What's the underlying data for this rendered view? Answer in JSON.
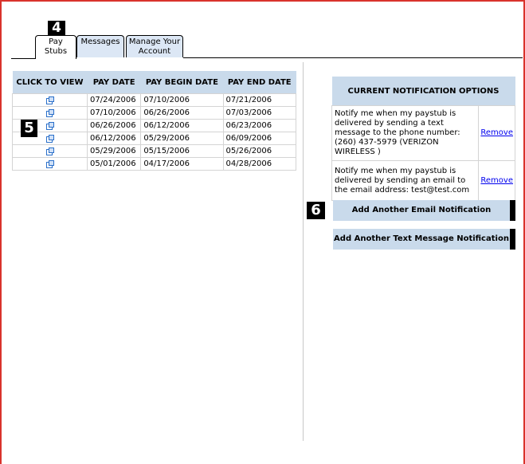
{
  "callouts": {
    "c4": "4",
    "c5": "5",
    "c6": "6"
  },
  "tabs": [
    {
      "label": "Pay Stubs"
    },
    {
      "label": "Messages"
    },
    {
      "label": "Manage Your Account"
    }
  ],
  "paystubs": {
    "headers": [
      "CLICK TO VIEW",
      "PAY DATE",
      "PAY BEGIN DATE",
      "PAY END DATE"
    ],
    "rows": [
      {
        "pay_date": "07/24/2006",
        "begin": "07/10/2006",
        "end": "07/21/2006"
      },
      {
        "pay_date": "07/10/2006",
        "begin": "06/26/2006",
        "end": "07/03/2006"
      },
      {
        "pay_date": "06/26/2006",
        "begin": "06/12/2006",
        "end": "06/23/2006"
      },
      {
        "pay_date": "06/12/2006",
        "begin": "05/29/2006",
        "end": "06/09/2006"
      },
      {
        "pay_date": "05/29/2006",
        "begin": "05/15/2006",
        "end": "05/26/2006"
      },
      {
        "pay_date": "05/01/2006",
        "begin": "04/17/2006",
        "end": "04/28/2006"
      }
    ],
    "view_icon": "external-link-icon"
  },
  "notifications": {
    "header": "CURRENT NOTIFICATION OPTIONS",
    "items": [
      {
        "text": "Notify me when my paystub is delivered by sending a text message to the phone number: (260) 437-5979 (VERIZON WIRELESS )",
        "action": "Remove"
      },
      {
        "text": "Notify me when my paystub is delivered by sending an email to the email address: test@test.com",
        "action": "Remove"
      }
    ],
    "add_email": "Add Another Email Notification",
    "add_text": "Add Another Text Message Notification"
  },
  "colors": {
    "border": "#d9332c",
    "header_bg": "#c9daeb",
    "tab_bg": "#dce7f5",
    "link": "#0000ee"
  }
}
